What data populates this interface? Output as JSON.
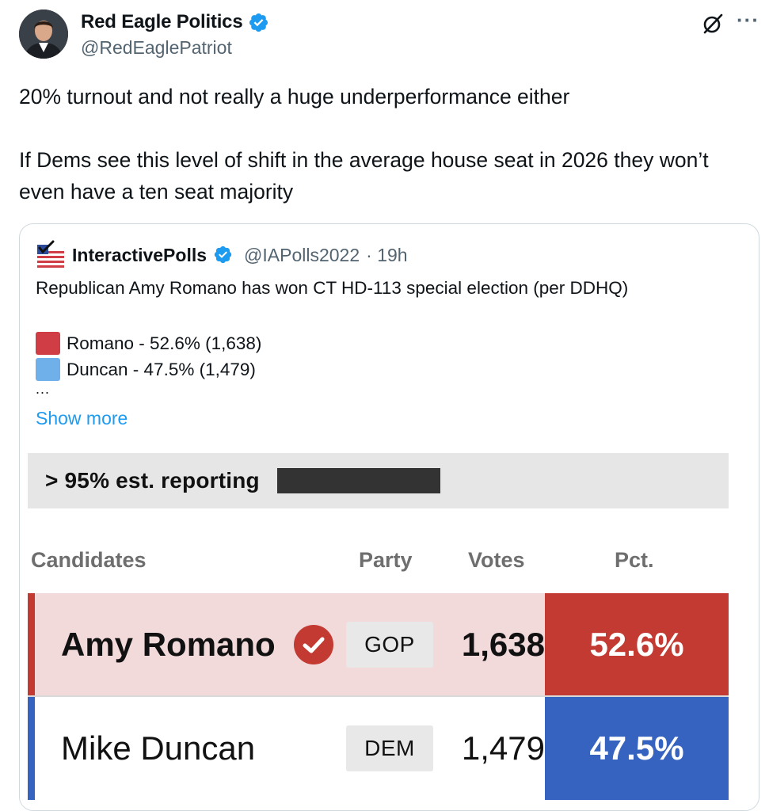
{
  "author": {
    "display_name": "Red Eagle Politics",
    "handle": "@RedEaglePatriot",
    "verified": true
  },
  "post": {
    "line1": "20% turnout and not really a huge underperformance either",
    "line2": "If Dems see this level of shift in the average house seat in 2026 they won’t even have a ten seat majority"
  },
  "icons": [
    "avatar",
    "verified-badge-icon",
    "grok-icon",
    "more-icon",
    "checkmark-icon"
  ],
  "quote": {
    "display_name": "InteractivePolls",
    "handle": "@IAPolls2022",
    "time": "· 19h",
    "text": "Republican Amy Romano has won CT HD-113 special election (per DDHQ)",
    "legend": [
      {
        "label": "Romano - 52.6% (1,638)",
        "color": "#d13d45"
      },
      {
        "label": "Duncan - 47.5% (1,479)",
        "color": "#6fb0ea"
      }
    ],
    "ellipsis": "...",
    "show_more": "Show more"
  },
  "results": {
    "reporting": "> 95% est. reporting",
    "headers": {
      "candidates": "Candidates",
      "party": "Party",
      "votes": "Votes",
      "pct": "Pct."
    },
    "rows": [
      {
        "name": "Amy Romano",
        "party": "GOP",
        "votes": "1,638",
        "pct": "52.6%",
        "winner": true,
        "color": "#c33a32"
      },
      {
        "name": "Mike Duncan",
        "party": "DEM",
        "votes": "1,479",
        "pct": "47.5%",
        "winner": false,
        "color": "#3662c0"
      }
    ]
  }
}
